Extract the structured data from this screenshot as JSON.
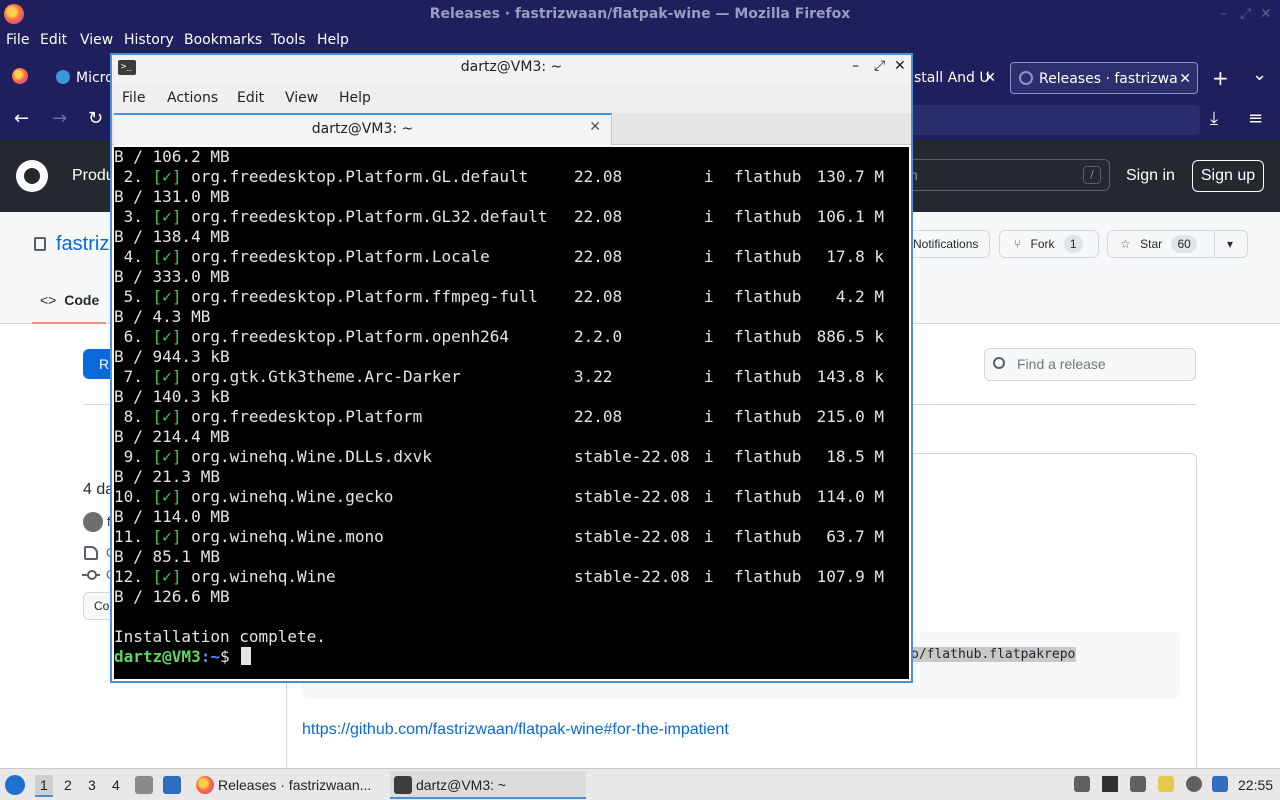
{
  "firefox": {
    "window_title": "Releases · fastrizwaan/flatpak-wine — Mozilla Firefox",
    "menu": [
      "File",
      "Edit",
      "View",
      "History",
      "Bookmarks",
      "Tools",
      "Help"
    ],
    "tabs": [
      {
        "label": "Micro"
      },
      {
        "label": "stall And U"
      },
      {
        "label": "Releases · fastrizwa"
      }
    ],
    "new_tab": "+",
    "tab_list": "⌄",
    "close_tab": "✕"
  },
  "github": {
    "header": {
      "products": "Produ",
      "search_placeholder": "ch",
      "search_shortcut": "/",
      "sign_in": "Sign in",
      "sign_up": "Sign up"
    },
    "repo": {
      "name": "fastriz",
      "notifications": "Notifications",
      "fork_label": "Fork",
      "fork_count": "1",
      "star_label": "Star",
      "star_count": "60"
    },
    "tabs": {
      "code": "Code"
    },
    "releases_button": "R",
    "find_release_placeholder": "Find a release",
    "release": {
      "days_ago": "4 da",
      "author_initial": "f",
      "tag_initial": "C",
      "commit_initial": "C",
      "compare_label": "Co",
      "snippet_visible": "o/flathub.flatpakrepo",
      "link": "https://github.com/fastrizwaan/flatpak-wine#for-the-impatient"
    }
  },
  "terminal": {
    "window_title": "dartz@VM3: ~",
    "menu": [
      "File",
      "Actions",
      "Edit",
      "View",
      "Help"
    ],
    "tab_label": "dartz@VM3: ~",
    "first_line": "B / 106.2 MB",
    "packages": [
      {
        "num": " 2.",
        "ref": "org.freedesktop.Platform.GL.default",
        "version": "22.08",
        "op": "i",
        "remote": "flathub",
        "size": "130.7 M",
        "cont": "B / 131.0 MB"
      },
      {
        "num": " 3.",
        "ref": "org.freedesktop.Platform.GL32.default",
        "version": "22.08",
        "op": "i",
        "remote": "flathub",
        "size": "106.1 M",
        "cont": "B / 138.4 MB"
      },
      {
        "num": " 4.",
        "ref": "org.freedesktop.Platform.Locale",
        "version": "22.08",
        "op": "i",
        "remote": "flathub",
        "size": "17.8 k",
        "cont": "B / 333.0 MB"
      },
      {
        "num": " 5.",
        "ref": "org.freedesktop.Platform.ffmpeg-full",
        "version": "22.08",
        "op": "i",
        "remote": "flathub",
        "size": "4.2 M",
        "cont": "B / 4.3 MB"
      },
      {
        "num": " 6.",
        "ref": "org.freedesktop.Platform.openh264",
        "version": "2.2.0",
        "op": "i",
        "remote": "flathub",
        "size": "886.5 k",
        "cont": "B / 944.3 kB"
      },
      {
        "num": " 7.",
        "ref": "org.gtk.Gtk3theme.Arc-Darker",
        "version": "3.22",
        "op": "i",
        "remote": "flathub",
        "size": "143.8 k",
        "cont": "B / 140.3 kB"
      },
      {
        "num": " 8.",
        "ref": "org.freedesktop.Platform",
        "version": "22.08",
        "op": "i",
        "remote": "flathub",
        "size": "215.0 M",
        "cont": "B / 214.4 MB"
      },
      {
        "num": " 9.",
        "ref": "org.winehq.Wine.DLLs.dxvk",
        "version": "stable-22.08",
        "op": "i",
        "remote": "flathub",
        "size": "18.5 M",
        "cont": "B / 21.3 MB"
      },
      {
        "num": "10.",
        "ref": "org.winehq.Wine.gecko",
        "version": "stable-22.08",
        "op": "i",
        "remote": "flathub",
        "size": "114.0 M",
        "cont": "B / 114.0 MB"
      },
      {
        "num": "11.",
        "ref": "org.winehq.Wine.mono",
        "version": "stable-22.08",
        "op": "i",
        "remote": "flathub",
        "size": "63.7 M",
        "cont": "B / 85.1 MB"
      },
      {
        "num": "12.",
        "ref": "org.winehq.Wine",
        "version": "stable-22.08",
        "op": "i",
        "remote": "flathub",
        "size": "107.9 M",
        "cont": "B / 126.6 MB"
      }
    ],
    "check_mark": "[✓]",
    "complete_message": "Installation complete.",
    "prompt_user": "dartz@VM3",
    "prompt_path": ":~",
    "prompt_symbol": "$"
  },
  "taskbar": {
    "workspaces": [
      "1",
      "2",
      "3",
      "4"
    ],
    "tasks": [
      {
        "label": "Releases · fastrizwaan..."
      },
      {
        "label": "dartz@VM3: ~"
      }
    ],
    "clock": "22:55"
  },
  "colors": {
    "firefox_chrome": "#1e1f5c",
    "github_header": "#24292f",
    "github_link": "#0969da",
    "terminal_bg": "#000000",
    "terminal_check": "#4ec94e",
    "prompt_user": "#5fd75f",
    "prompt_path": "#5f87ff",
    "focus_border": "#4a90d9"
  }
}
